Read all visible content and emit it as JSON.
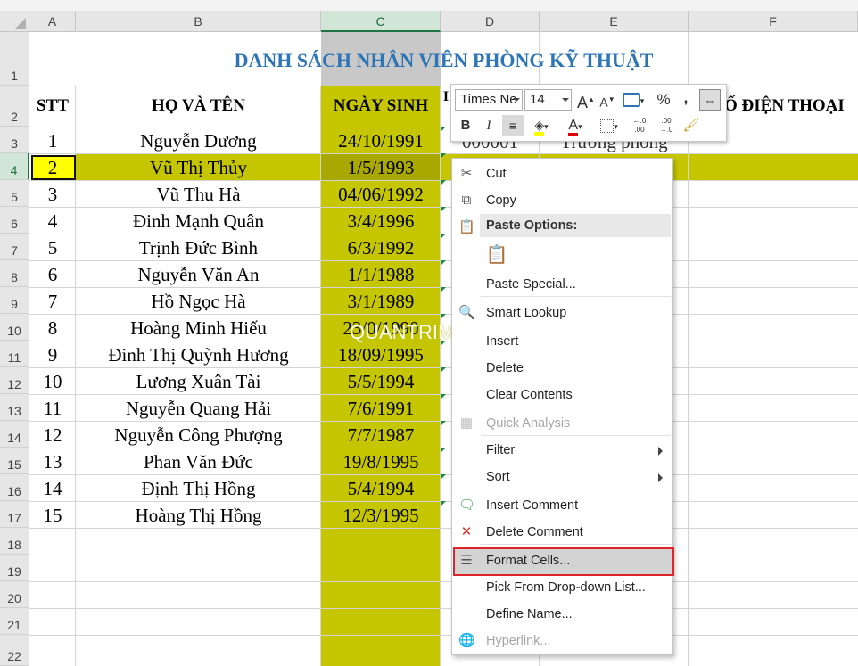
{
  "columns": [
    "A",
    "B",
    "C",
    "D",
    "E",
    "F"
  ],
  "selected_column": "C",
  "rows": [
    "1",
    "2",
    "3",
    "4",
    "5",
    "6",
    "7",
    "8",
    "9",
    "10",
    "11",
    "12",
    "13",
    "14",
    "15",
    "16",
    "17",
    "18",
    "19",
    "20",
    "21",
    "22"
  ],
  "selected_row": "4",
  "sheet": {
    "title": "DANH SÁCH NHÂN VIÊN PHÒNG KỸ THUẬT",
    "headers": {
      "stt": "STT",
      "name": "HỌ VÀ TÊN",
      "dob": "NGÀY SINH",
      "phone": "Ố ĐIỆN THOẠI"
    },
    "employees": [
      {
        "stt": "1",
        "name": "Nguyễn Dương",
        "dob": "24/10/1991"
      },
      {
        "stt": "2",
        "name": "Vũ Thị Thủy",
        "dob": "1/5/1993"
      },
      {
        "stt": "3",
        "name": "Vũ Thu Hà",
        "dob": "04/06/1992"
      },
      {
        "stt": "4",
        "name": "Đinh Mạnh Quân",
        "dob": "3/4/1996"
      },
      {
        "stt": "5",
        "name": "Trịnh Đức Bình",
        "dob": "6/3/1992"
      },
      {
        "stt": "6",
        "name": "Nguyễn Văn An",
        "dob": "1/1/1988"
      },
      {
        "stt": "7",
        "name": "Hồ Ngọc Hà",
        "dob": "3/1/1989"
      },
      {
        "stt": "8",
        "name": "Hoàng Minh Hiếu",
        "dob": "23/0/1990"
      },
      {
        "stt": "9",
        "name": "Đinh Thị Quỳnh Hương",
        "dob": "18/09/1995"
      },
      {
        "stt": "10",
        "name": "Lương Xuân Tài",
        "dob": "5/5/1994"
      },
      {
        "stt": "11",
        "name": "Nguyễn Quang Hải",
        "dob": "7/6/1991"
      },
      {
        "stt": "12",
        "name": "Nguyễn Công Phượng",
        "dob": "7/7/1987"
      },
      {
        "stt": "13",
        "name": "Phan Văn Đức",
        "dob": "19/8/1995"
      },
      {
        "stt": "14",
        "name": "Định Thị Hồng",
        "dob": "5/4/1994"
      },
      {
        "stt": "15",
        "name": "Hoàng Thị Hồng",
        "dob": "12/3/1995"
      }
    ],
    "d3_partial": "000001",
    "e3_partial": "Trưởng phòng",
    "d2_partial": "I",
    "highlight_color": "#c6c600"
  },
  "mini_toolbar": {
    "font_name": "Times Ne",
    "font_size": "14",
    "bold": "B",
    "italic": "I",
    "percent": "%",
    "comma": ",",
    "grow_font": "A",
    "shrink_font": "A",
    "font_color_letter": "A",
    "inc_decimal": "←.0 .00",
    "dec_decimal": ".00 →.0"
  },
  "watermark": "QUANTRIMAYTINH.COM",
  "context_menu": {
    "paste_options_heading": "Paste Options:",
    "items": [
      {
        "label": "Cut",
        "icon": "scissors-icon"
      },
      {
        "label": "Copy",
        "icon": "copy-icon"
      },
      {
        "label": "Paste Special...",
        "icon": ""
      },
      {
        "label": "Smart Lookup",
        "icon": "smart-lookup-icon"
      },
      {
        "label": "Insert",
        "icon": ""
      },
      {
        "label": "Delete",
        "icon": ""
      },
      {
        "label": "Clear Contents",
        "icon": ""
      },
      {
        "label": "Quick Analysis",
        "icon": "quick-analysis-icon",
        "disabled": true
      },
      {
        "label": "Filter",
        "icon": "",
        "submenu": true
      },
      {
        "label": "Sort",
        "icon": "",
        "submenu": true
      },
      {
        "label": "Insert Comment",
        "icon": "insert-comment-icon"
      },
      {
        "label": "Delete Comment",
        "icon": "delete-comment-icon"
      },
      {
        "label": "Format Cells...",
        "icon": "format-cells-icon",
        "highlighted": true
      },
      {
        "label": "Pick From Drop-down List...",
        "icon": ""
      },
      {
        "label": "Define Name...",
        "icon": ""
      },
      {
        "label": "Hyperlink...",
        "icon": "hyperlink-icon",
        "disabled": true
      }
    ]
  }
}
